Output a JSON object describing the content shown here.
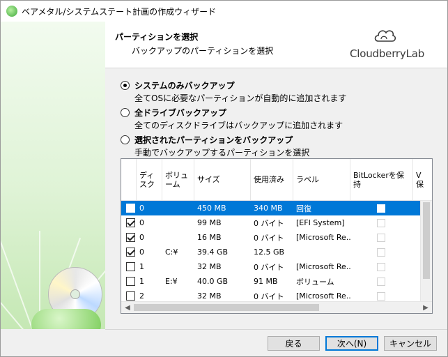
{
  "window": {
    "title": "ベアメタル/システムステート計画の作成ウィザード"
  },
  "header": {
    "title": "パーティションを選択",
    "subtitle": "バックアップのパーティションを選択",
    "logo_text": "CloudberryLab"
  },
  "options": [
    {
      "label": "システムのみバックアップ",
      "desc": "全てOSに必要なパーティションが自動的に追加されます",
      "selected": true
    },
    {
      "label": "全ドライブバックアップ",
      "desc": "全てのディスクドライブはバックアップに追加されます",
      "selected": false
    },
    {
      "label": "選択されたパーティションをバックアップ",
      "desc": "手動でバックアップするパーティションを選択",
      "selected": false
    }
  ],
  "table": {
    "columns": [
      "",
      "ディスク",
      "ボリューム",
      "サイズ",
      "使用済み",
      "ラベル",
      "BitLockerを保持",
      "V\n保"
    ],
    "rows": [
      {
        "checked": true,
        "disk": "0",
        "volume": "",
        "size": "450 MB",
        "used": "340 MB",
        "label": "回復",
        "selected": true
      },
      {
        "checked": true,
        "disk": "0",
        "volume": "",
        "size": "99 MB",
        "used": "0 バイト",
        "label": "[EFI System]",
        "selected": false
      },
      {
        "checked": true,
        "disk": "0",
        "volume": "",
        "size": "16 MB",
        "used": "0 バイト",
        "label": "[Microsoft Re...",
        "selected": false
      },
      {
        "checked": true,
        "disk": "0",
        "volume": "C:¥",
        "size": "39.4 GB",
        "used": "12.5 GB",
        "label": "",
        "selected": false
      },
      {
        "checked": false,
        "disk": "1",
        "volume": "",
        "size": "32 MB",
        "used": "0 バイト",
        "label": "[Microsoft Re...",
        "selected": false
      },
      {
        "checked": false,
        "disk": "1",
        "volume": "E:¥",
        "size": "40.0 GB",
        "used": "91 MB",
        "label": "ボリューム",
        "selected": false
      },
      {
        "checked": false,
        "disk": "2",
        "volume": "",
        "size": "32 MB",
        "used": "0 バイト",
        "label": "[Microsoft Re...",
        "selected": false
      }
    ]
  },
  "buttons": {
    "back": "戻る",
    "next": "次へ(N)",
    "cancel": "キャンセル"
  },
  "colors": {
    "selection": "#0078d7",
    "sidebar": "#c5e8b4"
  }
}
